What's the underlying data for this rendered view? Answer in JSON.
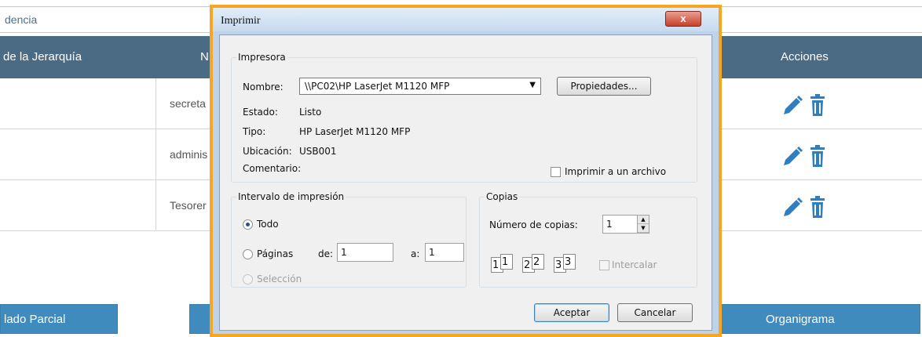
{
  "background": {
    "breadcrumb": "dencia",
    "table": {
      "headers": [
        "de la Jerarquía",
        "N",
        "Acciones"
      ],
      "rows": [
        {
          "name": "secreta"
        },
        {
          "name": "adminis"
        },
        {
          "name": "Tesorer"
        }
      ]
    },
    "buttons": {
      "left": "lado Parcial",
      "middle": "",
      "right": "Organigrama"
    },
    "colors": {
      "header": "#4b6a83",
      "button": "#3f8bbd",
      "icon": "#2f7fc0"
    }
  },
  "dialog": {
    "title": "Imprimir",
    "close_label": "x",
    "printer": {
      "group_label": "Impresora",
      "name_label": "Nombre:",
      "name_value": "\\\\PC02\\HP LaserJet M1120 MFP",
      "properties_button": "Propiedades...",
      "status_label": "Estado:",
      "status_value": "Listo",
      "type_label": "Tipo:",
      "type_value": "HP LaserJet M1120 MFP",
      "location_label": "Ubicación:",
      "location_value": "USB001",
      "comment_label": "Comentario:",
      "print_to_file_label": "Imprimir a un archivo"
    },
    "range": {
      "group_label": "Intervalo de impresión",
      "all_label": "Todo",
      "pages_label": "Páginas",
      "from_label": "de:",
      "from_value": "1",
      "to_label": "a:",
      "to_value": "1",
      "selection_label": "Selección"
    },
    "copies": {
      "group_label": "Copias",
      "count_label": "Número de copias:",
      "count_value": "1",
      "collate_label": "Intercalar",
      "collate_pages": [
        "1",
        "1",
        "2",
        "2",
        "3",
        "3"
      ]
    },
    "accept_button": "Aceptar",
    "cancel_button": "Cancelar",
    "highlight_color": "#f5a623"
  }
}
